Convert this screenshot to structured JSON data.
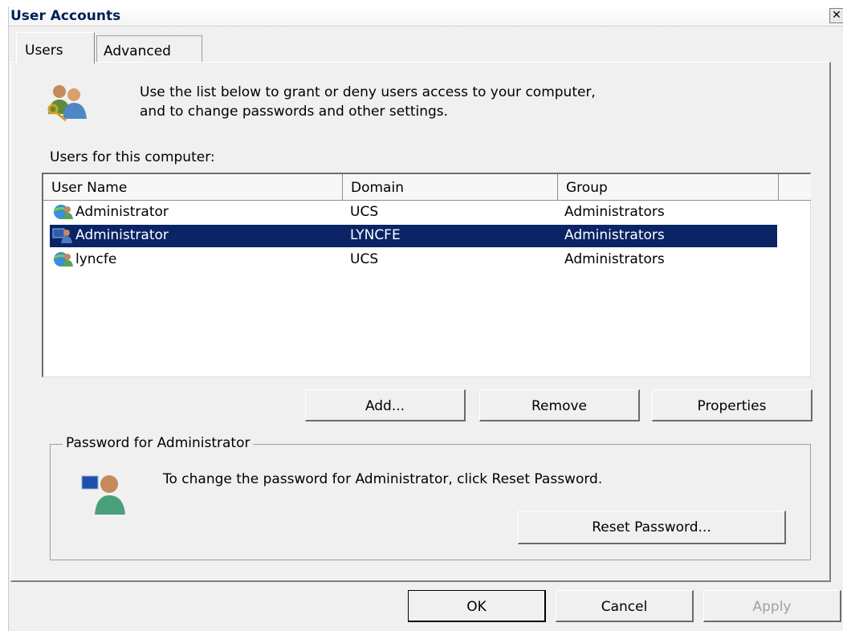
{
  "window": {
    "title": "User Accounts",
    "close_glyph": "✕"
  },
  "tabs": [
    {
      "label": "Users",
      "active": true
    },
    {
      "label": "Advanced",
      "active": false
    }
  ],
  "intro": {
    "icon": "users-keys-icon",
    "line1": "Use the list below to grant or deny users access to your computer,",
    "line2": "and to change passwords and other settings."
  },
  "users_list": {
    "label": "Users for this computer:",
    "columns": [
      "User Name",
      "Domain",
      "Group"
    ],
    "rows": [
      {
        "icon": "domain-user-icon",
        "name": "Administrator",
        "domain": "UCS",
        "group": "Administrators",
        "selected": false
      },
      {
        "icon": "local-user-icon",
        "name": "Administrator",
        "domain": "LYNCFE",
        "group": "Administrators",
        "selected": true
      },
      {
        "icon": "domain-user-icon",
        "name": "lyncfe",
        "domain": "UCS",
        "group": "Administrators",
        "selected": false
      }
    ]
  },
  "list_buttons": {
    "add": "Add...",
    "remove": "Remove",
    "properties": "Properties"
  },
  "password_group": {
    "title": "Password for Administrator",
    "icon": "user-password-icon",
    "text": "To change the password for Administrator, click Reset Password.",
    "reset_button": "Reset Password..."
  },
  "dialog_buttons": {
    "ok": "OK",
    "cancel": "Cancel",
    "apply": "Apply",
    "apply_enabled": false
  },
  "colors": {
    "selection": "#0a2466",
    "title_text": "#00205a",
    "face": "#f0f0f0"
  }
}
